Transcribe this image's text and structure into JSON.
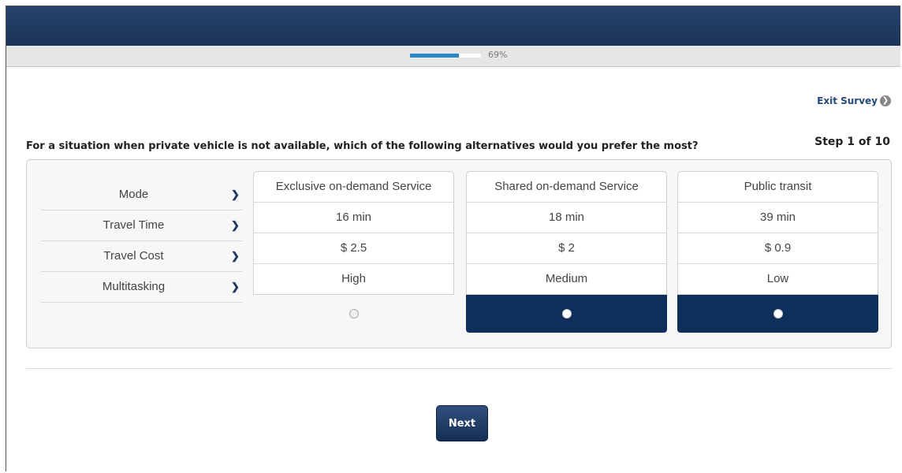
{
  "progress": {
    "percent_label": "69%",
    "fraction": 0.69
  },
  "exit_survey": {
    "label": "Exit Survey",
    "icon": "chevron-right-icon"
  },
  "step": "Step 1 of 10",
  "question": "For a situation when private vehicle is not available, which of the following alternatives would you prefer the most?",
  "attributes": [
    "Mode",
    "Travel Time",
    "Travel Cost",
    "Multitasking"
  ],
  "alternatives": [
    {
      "mode": "Exclusive on-demand Service",
      "time": "16 min",
      "cost": "$ 2.5",
      "multitasking": "High",
      "selected": false
    },
    {
      "mode": "Shared on-demand Service",
      "time": "18 min",
      "cost": "$ 2",
      "multitasking": "Medium",
      "selected": true
    },
    {
      "mode": "Public transit",
      "time": "39 min",
      "cost": "$ 0.9",
      "multitasking": "Low",
      "selected": true
    }
  ],
  "next_label": "Next",
  "colors": {
    "header": "#1b3558",
    "accent": "#0e2f5c",
    "progress": "#2a86c8",
    "link": "#234a7a"
  }
}
